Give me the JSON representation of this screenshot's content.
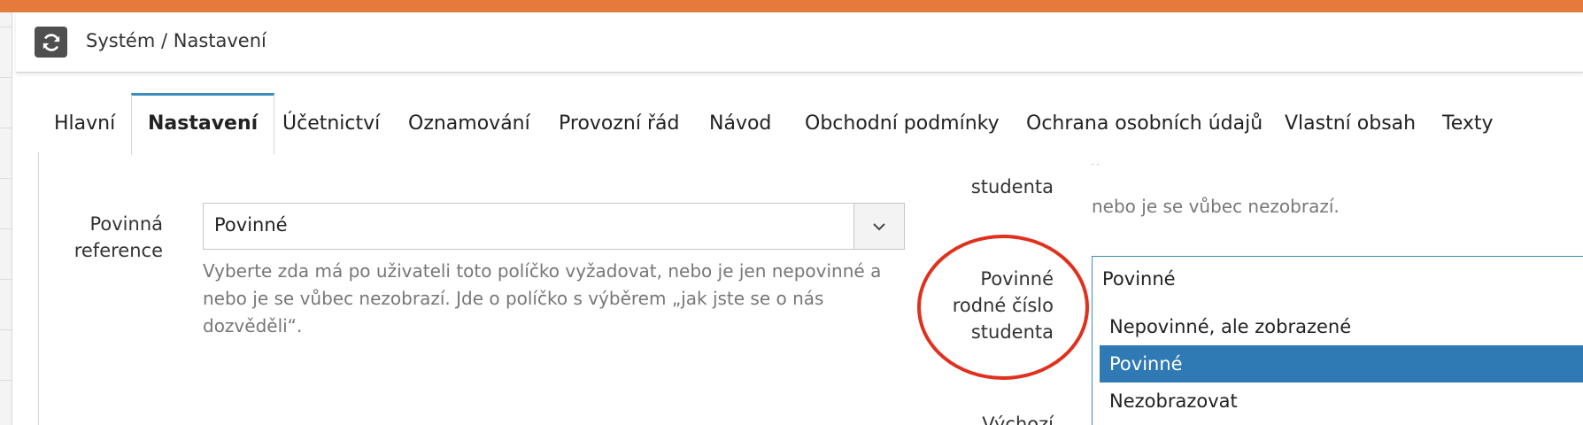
{
  "header": {
    "breadcrumb": "Systém / Nastavení",
    "refresh_icon": "refresh-icon"
  },
  "tabs": [
    {
      "label": "Hlavní",
      "active": false
    },
    {
      "label": "Nastavení",
      "active": true
    },
    {
      "label": "Účetnictví",
      "active": false
    },
    {
      "label": "Oznamování",
      "active": false
    },
    {
      "label": "Provozní řád",
      "active": false
    },
    {
      "label": "Návod",
      "active": false
    },
    {
      "label": "Obchodní podmínky",
      "active": false
    },
    {
      "label": "Ochrana osobních údajů",
      "active": false
    },
    {
      "label": "Vlastní obsah",
      "active": false
    },
    {
      "label": "Texty",
      "active": false
    }
  ],
  "left_column": {
    "reference_label_line1": "Povinná",
    "reference_label_line2": "reference",
    "reference_value": "Povinné",
    "reference_help_line1": "Vyberte zda má po uživateli toto políčko vyžadovat, nebo je jen nepovinné a",
    "reference_help_line2": "nebo je se vůbec nezobrazí. Jde o políčko s výběrem „jak jste se o nás",
    "reference_help_line3": "dozvěděli“."
  },
  "right_column": {
    "prev_label_tail": "studenta",
    "prev_help_tail": "nebo je se vůbec nezobrazí.",
    "rc_label_line1": "Povinné",
    "rc_label_line2": "rodné číslo",
    "rc_label_line3": "studenta",
    "rc_current_value": "Povinné",
    "rc_options": [
      {
        "label": "Nepovinné, ale zobrazené",
        "selected": false
      },
      {
        "label": "Povinné",
        "selected": true
      },
      {
        "label": "Nezobrazovat",
        "selected": false
      }
    ],
    "next_label_partial": "Výchozí"
  },
  "colors": {
    "topbar": "#e47b3a",
    "tab_accent": "#3c8dbc",
    "selected_option": "#2f7ab5",
    "annotation_circle": "#e0301e"
  }
}
